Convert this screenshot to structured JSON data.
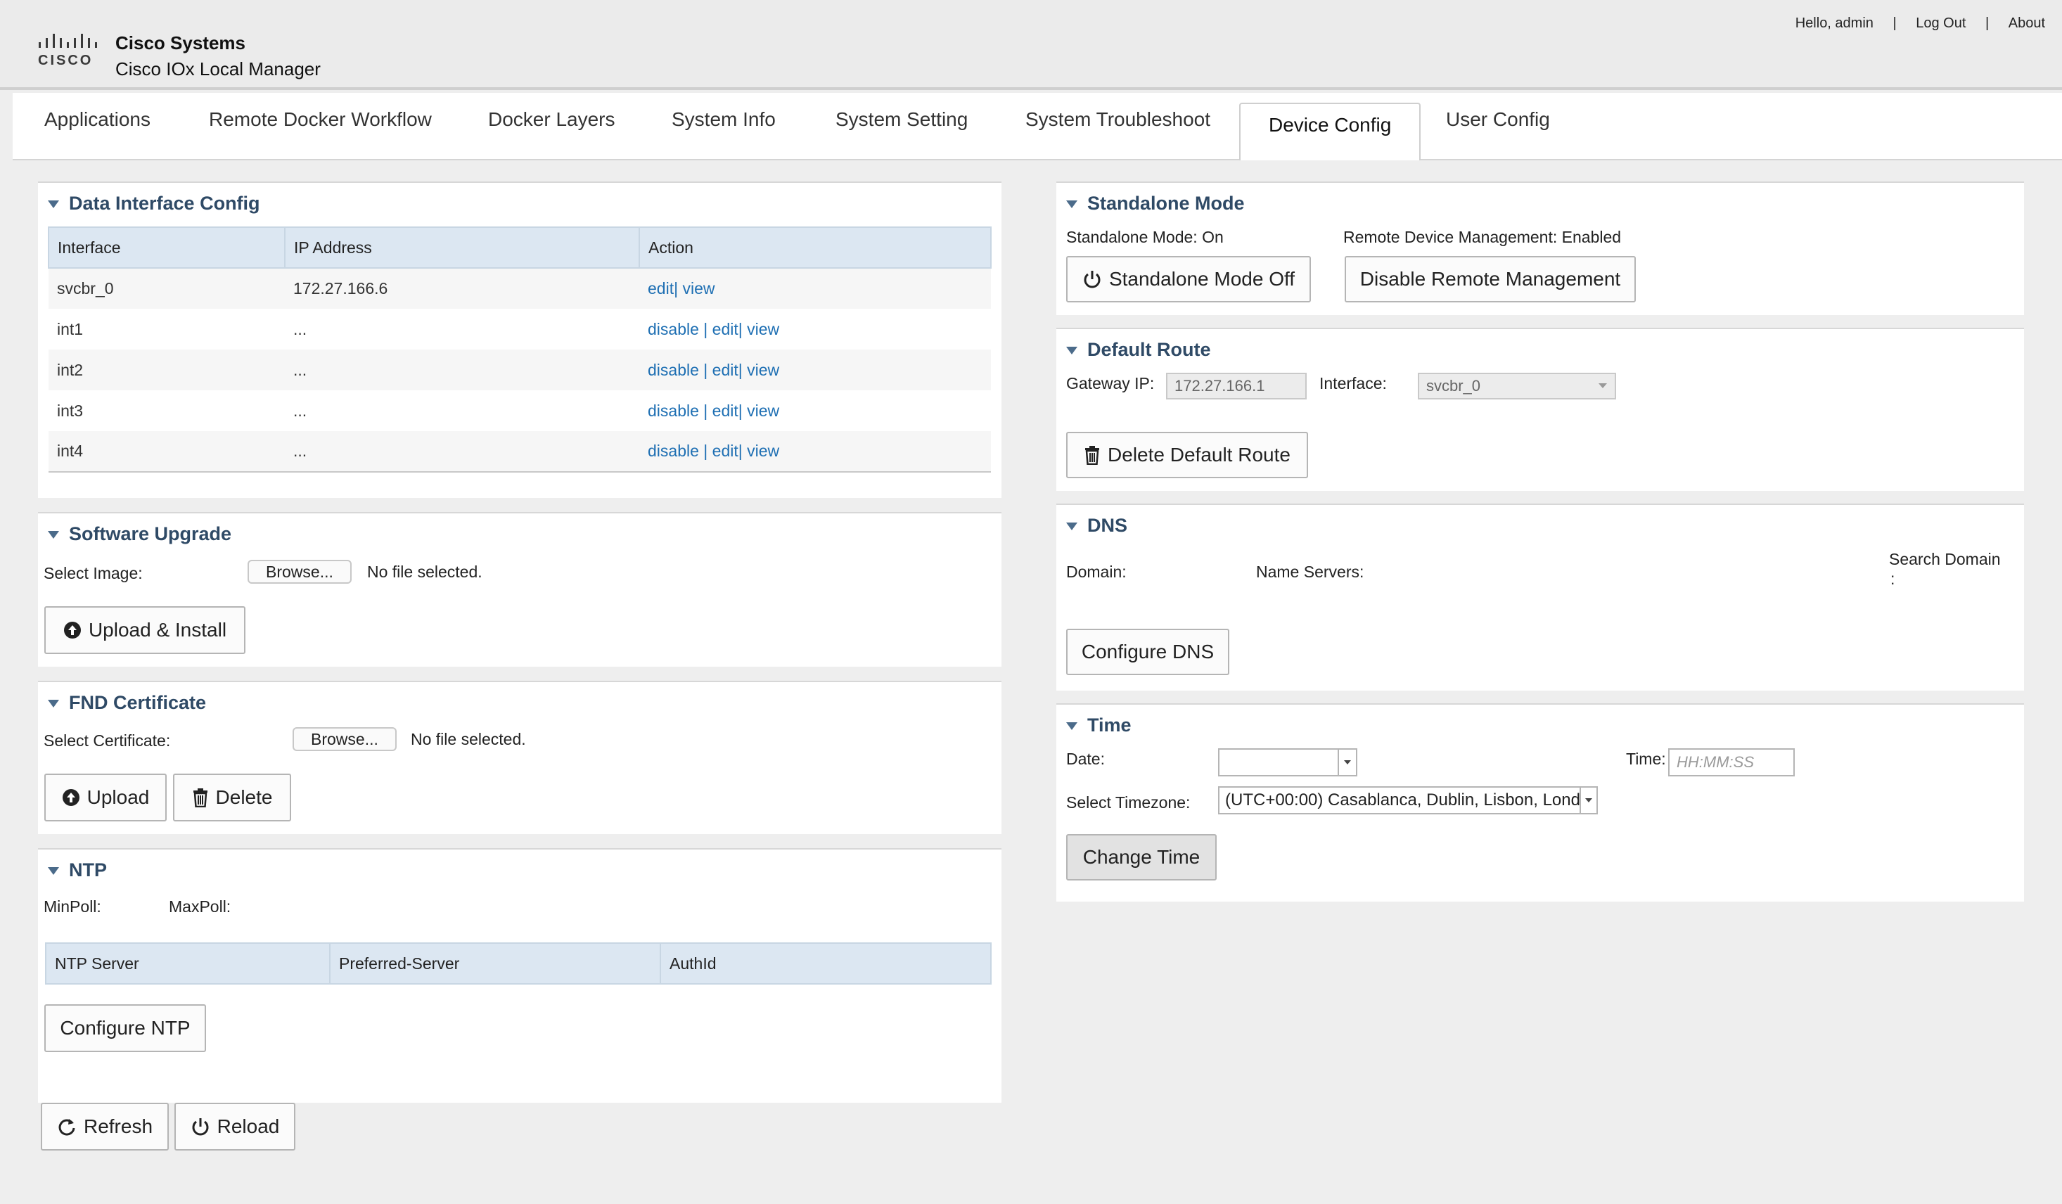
{
  "header": {
    "company": "Cisco Systems",
    "product": "Cisco IOx Local Manager",
    "logo_text": "CISCO",
    "greeting": "Hello, admin",
    "logout": "Log Out",
    "about": "About",
    "separator": "|"
  },
  "tabs": [
    {
      "label": "Applications"
    },
    {
      "label": "Remote Docker Workflow"
    },
    {
      "label": "Docker Layers"
    },
    {
      "label": "System Info"
    },
    {
      "label": "System Setting"
    },
    {
      "label": "System Troubleshoot"
    },
    {
      "label": "Device Config"
    },
    {
      "label": "User Config"
    }
  ],
  "active_tab": "Device Config",
  "data_interface": {
    "title": "Data Interface Config",
    "columns": [
      "Interface",
      "IP Address",
      "Action"
    ],
    "rows": [
      {
        "interface": "svcbr_0",
        "ip": "172.27.166.6",
        "disable": "",
        "sep1": "",
        "edit": "edit",
        "sep2": "|",
        "view": "view"
      },
      {
        "interface": "int1",
        "ip": "...",
        "disable": "disable",
        "sep1": "|",
        "edit": "edit",
        "sep2": "|",
        "view": "view"
      },
      {
        "interface": "int2",
        "ip": "...",
        "disable": "disable",
        "sep1": "|",
        "edit": "edit",
        "sep2": "|",
        "view": "view"
      },
      {
        "interface": "int3",
        "ip": "...",
        "disable": "disable",
        "sep1": "|",
        "edit": "edit",
        "sep2": "|",
        "view": "view"
      },
      {
        "interface": "int4",
        "ip": "...",
        "disable": "disable",
        "sep1": "|",
        "edit": "edit",
        "sep2": "|",
        "view": "view"
      }
    ]
  },
  "software_upgrade": {
    "title": "Software Upgrade",
    "select_label": "Select Image:",
    "browse": "Browse...",
    "file_status": "No file selected.",
    "upload_button": "Upload & Install"
  },
  "fnd_certificate": {
    "title": "FND Certificate",
    "select_label": "Select Certificate:",
    "browse": "Browse...",
    "file_status": "No file selected.",
    "upload_button": "Upload",
    "delete_button": "Delete"
  },
  "ntp": {
    "title": "NTP",
    "minpoll_label": "MinPoll:",
    "maxpoll_label": "MaxPoll:",
    "columns": [
      "NTP Server",
      "Preferred-Server",
      "AuthId"
    ],
    "configure_button": "Configure NTP"
  },
  "bottom_buttons": {
    "refresh": "Refresh",
    "reload": "Reload"
  },
  "standalone": {
    "title": "Standalone Mode",
    "mode_status": "Standalone Mode: On",
    "remote_status": "Remote Device Management: Enabled",
    "mode_off_button": "Standalone Mode Off",
    "disable_remote_button": "Disable Remote Management"
  },
  "default_route": {
    "title": "Default Route",
    "gateway_label": "Gateway IP:",
    "gateway_value": "172.27.166.1",
    "interface_label": "Interface:",
    "interface_value": "svcbr_0",
    "delete_button": "Delete Default Route"
  },
  "dns": {
    "title": "DNS",
    "domain_label": "Domain:",
    "name_servers_label": "Name Servers:",
    "search_domain_label": "Search Domain",
    "search_domain_colon": ":",
    "configure_button": "Configure DNS"
  },
  "time": {
    "title": "Time",
    "date_label": "Date:",
    "date_value": "",
    "time_label": "Time:",
    "time_placeholder": "HH:MM:SS",
    "timezone_label": "Select Timezone:",
    "timezone_value": "(UTC+00:00) Casablanca, Dublin, Lisbon, Lond",
    "change_button": "Change Time"
  }
}
